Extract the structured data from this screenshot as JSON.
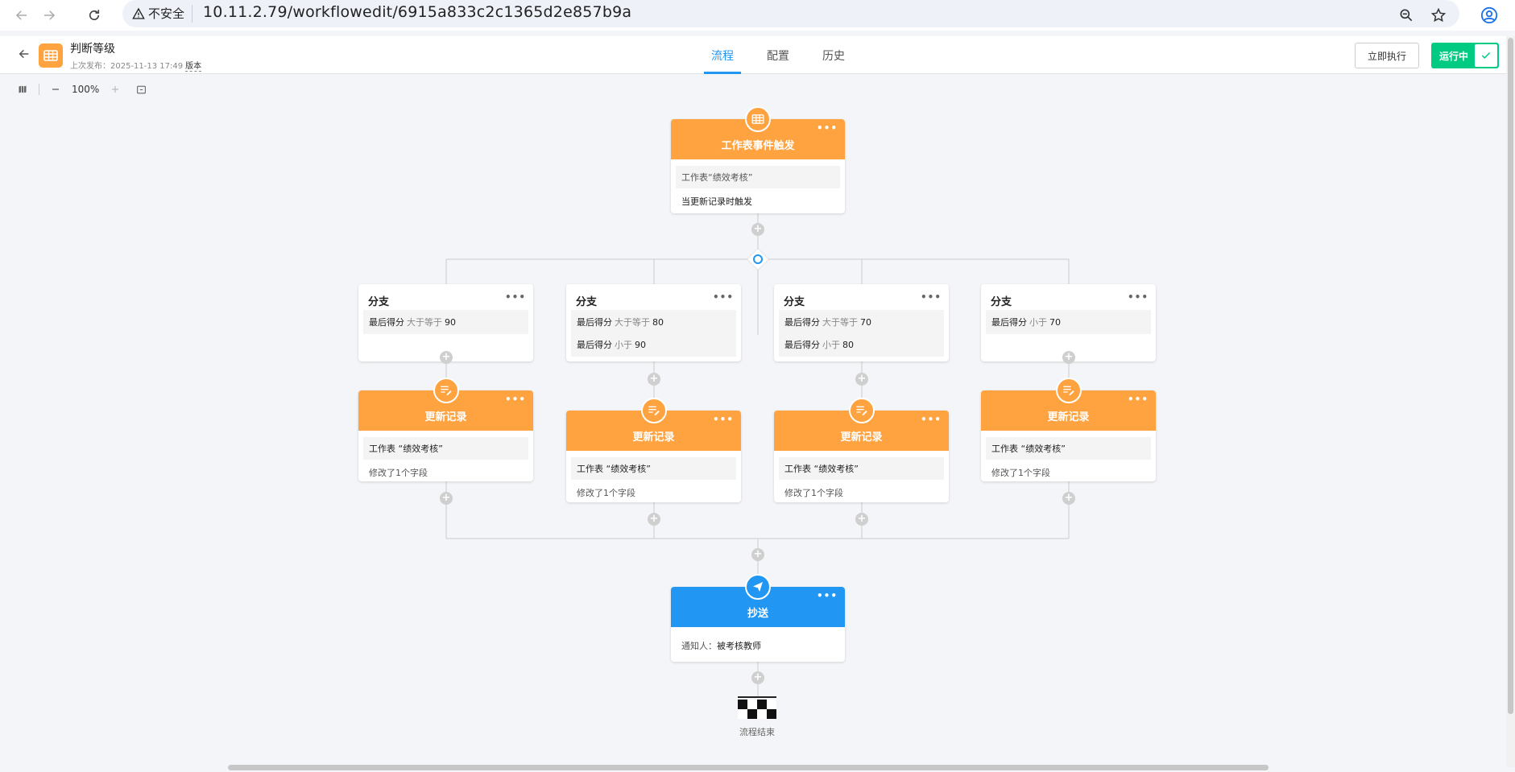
{
  "browser": {
    "security_label": "不安全",
    "url": "10.11.2.79/workflowedit/6915a833c2c1365d2e857b9a"
  },
  "header": {
    "title": "判断等级",
    "subtitle": "上次发布：2025-11-13 17:49",
    "version_label": "版本",
    "tabs": [
      {
        "label": "流程",
        "active": true
      },
      {
        "label": "配置",
        "active": false
      },
      {
        "label": "历史",
        "active": false
      }
    ],
    "run_now_label": "立即执行",
    "status_label": "运行中"
  },
  "toolbar": {
    "zoom": "100%"
  },
  "flow": {
    "trigger": {
      "title": "工作表事件触发",
      "sheet_line": "工作表“绩效考核”",
      "trigger_line": "当更新记录时触发"
    },
    "branches": [
      {
        "title": "分支",
        "conditions": [
          {
            "field": "最后得分",
            "op": "大于等于",
            "value": "90"
          }
        ],
        "update": {
          "title": "更新记录",
          "sheet_line": "工作表 “绩效考核”",
          "change_line": "修改了1个字段"
        }
      },
      {
        "title": "分支",
        "conditions": [
          {
            "field": "最后得分",
            "op": "大于等于",
            "value": "80"
          },
          {
            "field": "最后得分",
            "op": "小于",
            "value": "90"
          }
        ],
        "update": {
          "title": "更新记录",
          "sheet_line": "工作表 “绩效考核”",
          "change_line": "修改了1个字段"
        }
      },
      {
        "title": "分支",
        "conditions": [
          {
            "field": "最后得分",
            "op": "大于等于",
            "value": "70"
          },
          {
            "field": "最后得分",
            "op": "小于",
            "value": "80"
          }
        ],
        "update": {
          "title": "更新记录",
          "sheet_line": "工作表 “绩效考核”",
          "change_line": "修改了1个字段"
        }
      },
      {
        "title": "分支",
        "conditions": [
          {
            "field": "最后得分",
            "op": "小于",
            "value": "70"
          }
        ],
        "update": {
          "title": "更新记录",
          "sheet_line": "工作表 “绩效考核”",
          "change_line": "修改了1个字段"
        }
      }
    ],
    "cc": {
      "title": "抄送",
      "notify_label": "通知人：",
      "notify_value": "被考核教师"
    },
    "end_label": "流程结束"
  },
  "colors": {
    "accent": "#2196f3",
    "trigger_orange": "#ffa340",
    "running_green": "#01ca83"
  }
}
